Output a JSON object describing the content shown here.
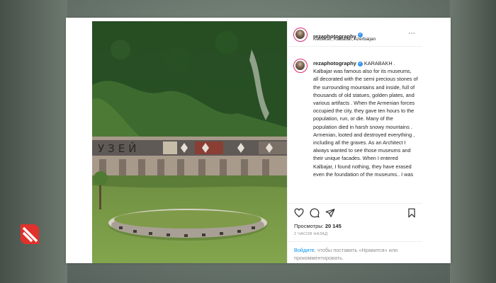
{
  "post": {
    "username": "rezaphotography",
    "location": "Kəlbəcər, Kalbacar, Azerbaijan",
    "caption_intro": "KARABAKH .",
    "caption_body": "Kalbajar was famous also for its museums, all decorated with the semi precious stones of the surrounding mountains and inside, full of thousands of old statues, golden plates, and various artifacts . When the Armenian forces occupied the city, they gave ten hours to the population, run, or die. Many of the population died in harsh snowy mountains . Armenian, looted and destroyed everything , including all the graves. As an Architect I always wanted to see those museums and their unique facades. When I entered Kalbajar, I found nothing, they have erased even the foundation of the museums.. I was",
    "views_label": "Просмотры:",
    "views_count": "20 145",
    "time_ago": "2 ЧАСОВ НАЗАД",
    "login_link": "Войдите",
    "login_text": ", чтобы поставить «Нравится» или прокомментировать.",
    "more_icon": "⋯"
  },
  "photo": {
    "wall_text": "УЗЕЙ"
  },
  "icons": [
    "heart-icon",
    "comment-icon",
    "share-icon",
    "bookmark-icon",
    "more-options-icon",
    "verified-icon",
    "brand-logo-icon"
  ],
  "colors": {
    "link": "#0095f6",
    "verified": "#3897f0",
    "logo": "#e0312b"
  }
}
